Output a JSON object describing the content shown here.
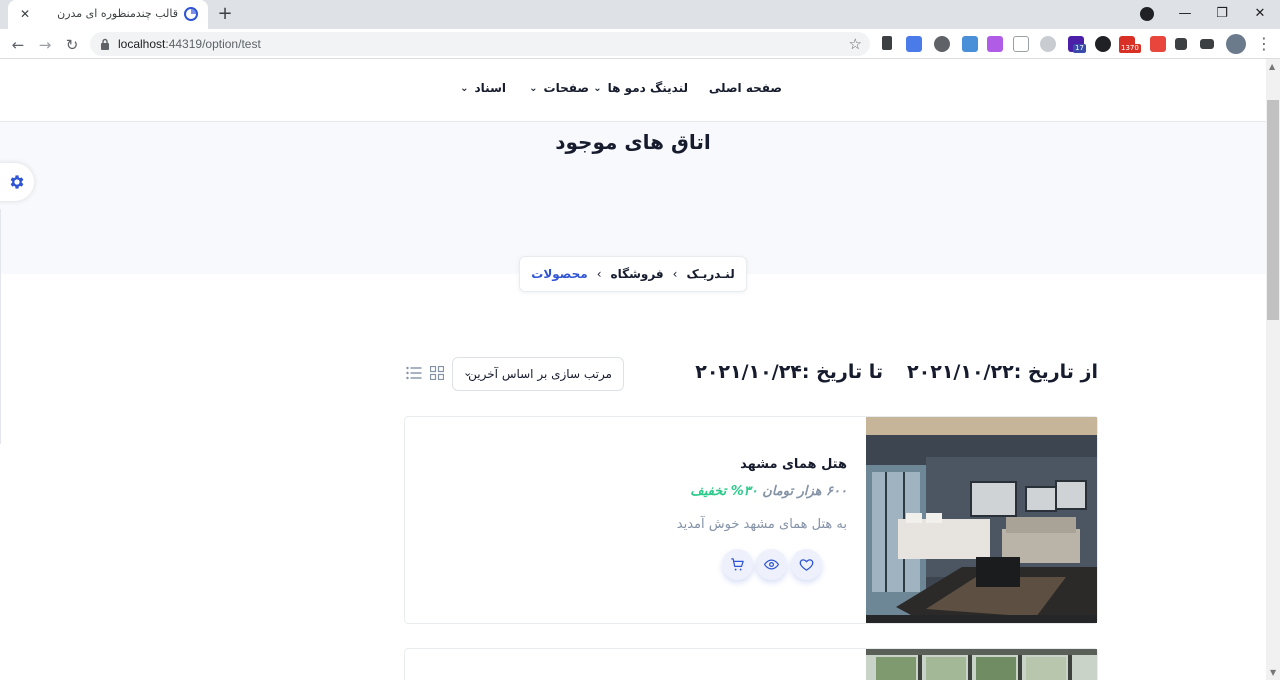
{
  "browser": {
    "tab_title": "قالب چندمنظوره ای مدرن",
    "tab_close": "✕",
    "new_tab": "+",
    "url_host": "localhost",
    "url_rest": ":44319/option/test",
    "window_controls": {
      "minimize": "—",
      "maximize": "❐",
      "close": "✕"
    },
    "back_label": "←",
    "forward_label": "→",
    "reload_label": "↻",
    "star_label": "☆",
    "menu_label": "⋮",
    "extension_badges": {
      "ext_17": "17",
      "ext_1370": "1370"
    }
  },
  "nav": {
    "items": [
      {
        "label": "صفحه اصلی",
        "has_dropdown": false
      },
      {
        "label": "لندینگ دمو ها",
        "has_dropdown": true
      },
      {
        "label": "صفحات",
        "has_dropdown": true
      },
      {
        "label": "اسناد",
        "has_dropdown": true
      }
    ],
    "chevron": "⌄"
  },
  "hero": {
    "title": "اتاق های موجود"
  },
  "breadcrumb": {
    "items": [
      "لنـدریـک",
      "فروشگاه",
      "محصولات"
    ],
    "separator": "›"
  },
  "filter": {
    "from_label": "از تاریخ :۲۰۲۱/۱۰/۲۲",
    "to_label": "تا تاریخ :۲۰۲۱/۱۰/۲۴",
    "sort_label": "مرتب سازی بر اساس آخرین",
    "sort_chevron": "⌄"
  },
  "products": [
    {
      "name": "هتل همای مشهد",
      "price": "۶۰۰ هزار تومان",
      "discount": "۳۰% تخفیف",
      "description": "به هتل همای مشهد خوش آمدید"
    }
  ],
  "colors": {
    "primary": "#2f55d4",
    "success": "#2eca8b",
    "muted": "#8492a6",
    "dark": "#161c2d",
    "hero_bg": "#f8f9fc"
  },
  "icons": {
    "settings": "gear-icon",
    "grid": "grid-view-icon",
    "list": "list-view-icon",
    "wishlist": "heart-icon",
    "view": "eye-icon",
    "cart": "cart-icon"
  }
}
